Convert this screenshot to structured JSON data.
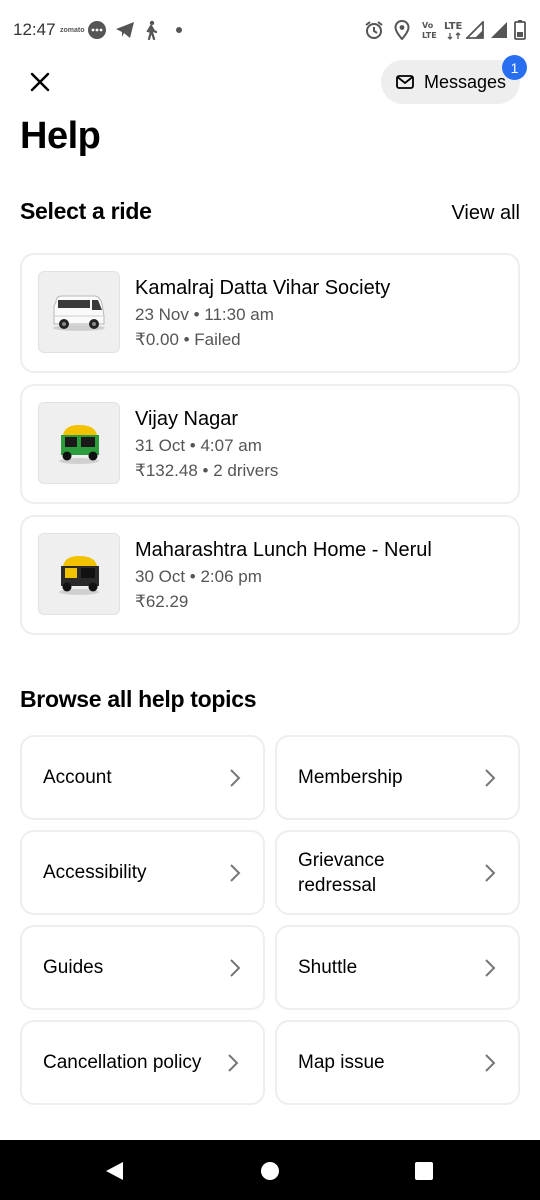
{
  "status_bar": {
    "time": "12:47",
    "zomato_label": "zomato",
    "network_label": "LTE",
    "icons": [
      "zomato-icon",
      "chat-bubble-icon",
      "telegram-icon",
      "walking-icon",
      "dot-icon",
      "alarm-icon",
      "location-icon",
      "volte-icon",
      "lte-icon",
      "signal-icon",
      "signal-icon",
      "battery-icon"
    ]
  },
  "header": {
    "messages_label": "Messages",
    "messages_badge": "1",
    "title": "Help"
  },
  "select_ride": {
    "heading": "Select a ride",
    "view_all": "View all",
    "rides": [
      {
        "title": "Kamalraj Datta Vihar Society",
        "datetime": "23 Nov • 11:30 am",
        "detail": "₹0.00 • Failed",
        "vehicle": "van"
      },
      {
        "title": "Vijay Nagar",
        "datetime": "31 Oct • 4:07 am",
        "detail": "₹132.48 • 2 drivers",
        "vehicle": "auto-rickshaw-green"
      },
      {
        "title": "Maharashtra Lunch Home - Nerul",
        "datetime": "30 Oct • 2:06 pm",
        "detail": "₹62.29",
        "vehicle": "auto-rickshaw-black"
      }
    ]
  },
  "help_topics": {
    "heading": "Browse all help topics",
    "items": [
      {
        "label": "Account"
      },
      {
        "label": "Membership"
      },
      {
        "label": "Accessibility"
      },
      {
        "label": "Grievance redressal"
      },
      {
        "label": "Guides"
      },
      {
        "label": "Shuttle"
      },
      {
        "label": "Cancellation policy"
      },
      {
        "label": "Map issue"
      }
    ]
  },
  "colors": {
    "accent": "#276ef1",
    "card_border": "#eeeeee",
    "pill_bg": "#eeeeee",
    "nav_bar": "#000000"
  }
}
